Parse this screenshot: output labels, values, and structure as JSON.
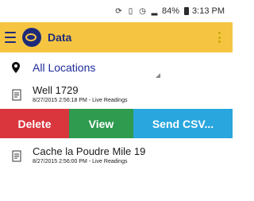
{
  "statusbar": {
    "battery": "84%",
    "time": "3:13 PM",
    "icons": [
      "sync-icon",
      "vibrate-icon",
      "alarm-icon",
      "signal-icon",
      "battery-icon"
    ]
  },
  "appbar": {
    "title": "Data",
    "color": "#f5c542",
    "accent": "#1e2b7a",
    "icons": [
      "menu-icon",
      "app-logo",
      "overflow-menu-icon"
    ]
  },
  "location": {
    "label": "All Locations",
    "icon": "map-pin-icon"
  },
  "items": [
    {
      "title": "Well 1729",
      "subtitle": "8/27/2015 2:56:18 PM - Live Readings",
      "icon": "document-icon"
    },
    {
      "title": "Cache la Poudre Mile 19",
      "subtitle": "8/27/2015 2:56:00 PM - Live Readings",
      "icon": "document-icon"
    }
  ],
  "actions": {
    "delete": "Delete",
    "view": "View",
    "send": "Send CSV...",
    "colors": {
      "delete": "#d9363e",
      "view": "#2e9b4f",
      "send": "#2aa6de"
    }
  }
}
